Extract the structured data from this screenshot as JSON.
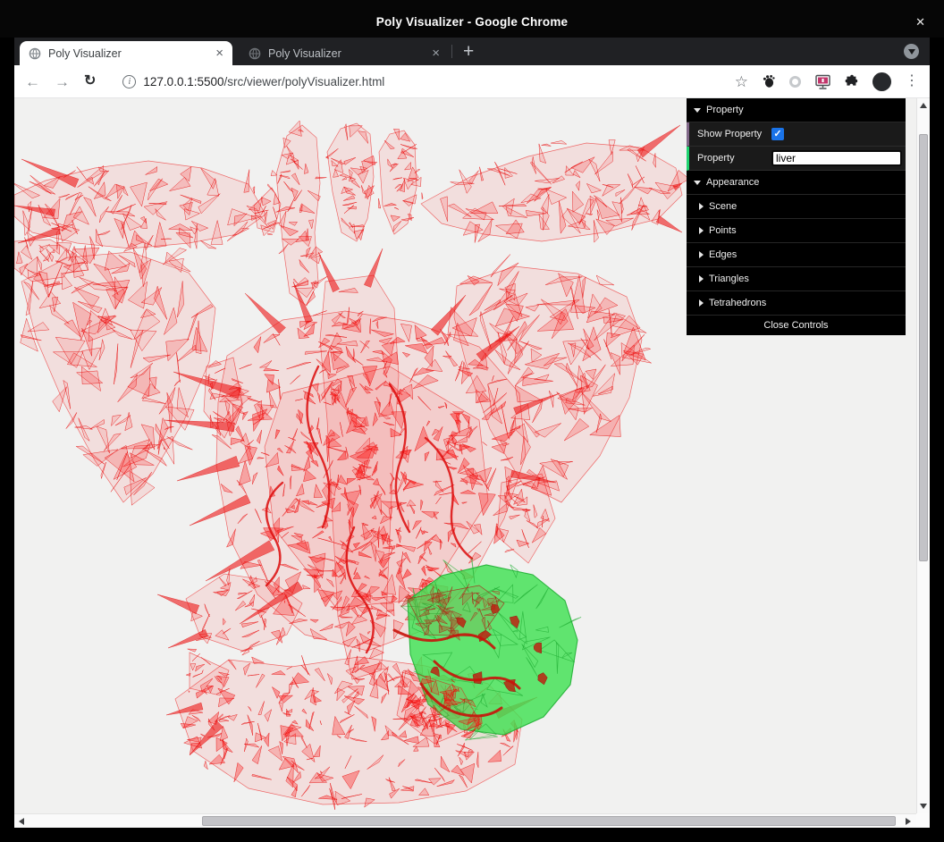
{
  "window": {
    "title": "Poly Visualizer - Google Chrome",
    "close_glyph": "✕"
  },
  "tabstrip": {
    "tabs": [
      {
        "label": "Poly Visualizer",
        "active": true,
        "close_glyph": "×"
      },
      {
        "label": "Poly Visualizer",
        "active": false,
        "close_glyph": "×"
      }
    ],
    "new_tab_glyph": "+"
  },
  "toolbar": {
    "back_glyph": "←",
    "forward_glyph": "→",
    "reload_glyph": "↻",
    "info_glyph": "i",
    "url_host": "127.0.0.1:5500",
    "url_path": "/src/viewer/polyVisualizer.html",
    "star_glyph": "☆",
    "menu_glyph": "⋮"
  },
  "gui": {
    "property_folder": "Property",
    "show_property_label": "Show Property",
    "show_property_checked": true,
    "property_label": "Property",
    "property_value": "liver",
    "appearance_folder": "Appearance",
    "subfolders": [
      "Scene",
      "Points",
      "Edges",
      "Triangles",
      "Tetrahedrons"
    ],
    "close_button": "Close Controls",
    "accent_boolean": "#806787",
    "accent_string": "#1ed36f"
  },
  "scene": {
    "mesh_color": "#ff2020",
    "highlight_color": "#3ce24f",
    "background_color": "#f1f1f0",
    "highlighted_property": "liver"
  }
}
